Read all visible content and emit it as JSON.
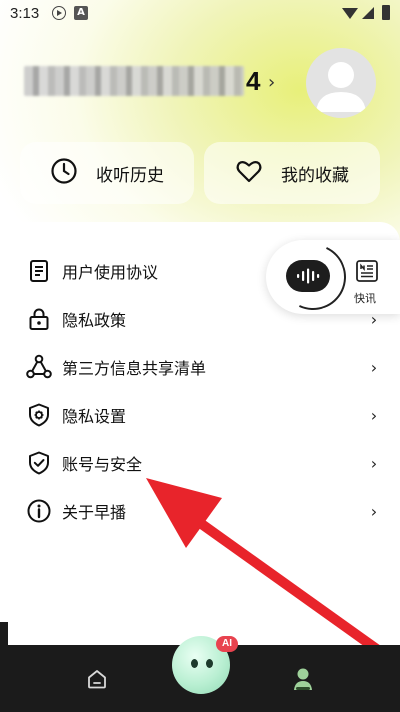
{
  "status_bar": {
    "time": "3:13",
    "icons": [
      "play-icon",
      "a-icon",
      "wifi-icon",
      "signal-icon",
      "battery-icon"
    ]
  },
  "profile": {
    "username_suffix": "4",
    "chevron": "›"
  },
  "quick_actions": [
    {
      "label": "收听历史",
      "icon": "clock-icon"
    },
    {
      "label": "我的收藏",
      "icon": "heart-icon"
    }
  ],
  "menu": [
    {
      "label": "用户使用协议",
      "icon": "document-icon"
    },
    {
      "label": "隐私政策",
      "icon": "lock-icon"
    },
    {
      "label": "第三方信息共享清单",
      "icon": "share-nodes-icon"
    },
    {
      "label": "隐私设置",
      "icon": "shield-gear-icon"
    },
    {
      "label": "账号与安全",
      "icon": "shield-check-icon"
    },
    {
      "label": "关于早播",
      "icon": "info-icon"
    }
  ],
  "menu_chevron": "›",
  "float_panel": {
    "news_label": "快讯"
  },
  "bottom_nav": {
    "ai_badge": "AI"
  },
  "colors": {
    "accent_gradient": "#e8f07a",
    "annotation_arrow": "#e8242b",
    "bottom_bar": "#1b1b1b"
  }
}
